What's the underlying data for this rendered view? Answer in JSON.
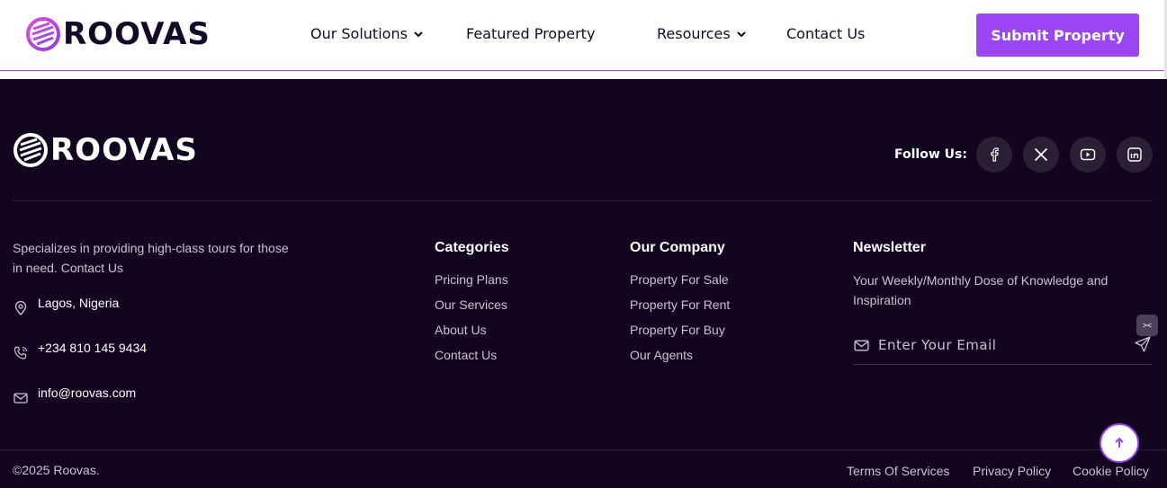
{
  "brand": {
    "name": "ROOVAS",
    "accent_color": "#9b45f5",
    "footer_bg": "#12051f"
  },
  "header": {
    "nav": [
      {
        "label": "Our Solutions",
        "has_dropdown": true,
        "icon": "chevron-down-icon"
      },
      {
        "label": "Featured Property",
        "has_dropdown": false
      },
      {
        "label": "Resources",
        "has_dropdown": true,
        "icon": "chevron-down-icon"
      },
      {
        "label": "Contact Us",
        "has_dropdown": false
      }
    ],
    "cta_label": "Submit Property"
  },
  "footer": {
    "follow_label": "Follow Us:",
    "socials": [
      "facebook-icon",
      "x-icon",
      "youtube-icon",
      "linkedin-icon"
    ],
    "about": "Specializes in providing high-class tours for those in need. Contact Us",
    "contacts": [
      {
        "icon": "location-pin-icon",
        "text": "Lagos, Nigeria"
      },
      {
        "icon": "phone-icon",
        "text": "+234 810 145 9434"
      },
      {
        "icon": "mail-icon",
        "text": "info@roovas.com"
      }
    ],
    "categories": {
      "title": "Categories",
      "links": [
        "Pricing Plans",
        "Our Services",
        "About Us",
        "Contact Us"
      ]
    },
    "company": {
      "title": "Our Company",
      "links": [
        "Property For Sale",
        "Property For Rent",
        "Property For Buy",
        "Our Agents"
      ]
    },
    "newsletter": {
      "title": "Newsletter",
      "description": "Your Weekly/Monthly Dose of Knowledge and Inspiration",
      "placeholder": "Enter Your Email"
    },
    "copyright": "©2025 Roovas.",
    "legal": [
      "Terms Of Services",
      "Privacy Policy",
      "Cookie Policy"
    ]
  }
}
